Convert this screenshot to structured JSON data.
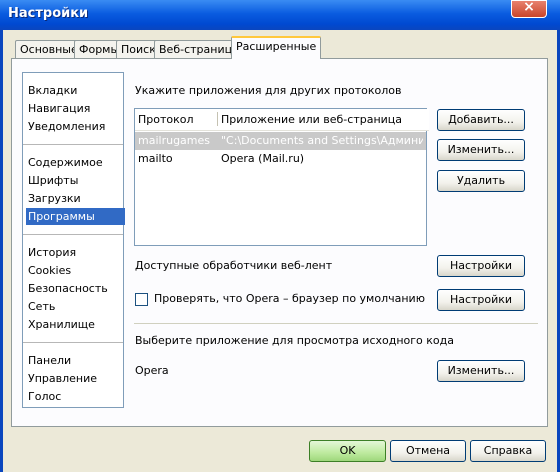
{
  "window": {
    "title": "Настройки"
  },
  "tabs": [
    {
      "label": "Основные",
      "active": false
    },
    {
      "label": "Формы",
      "active": false
    },
    {
      "label": "Поиск",
      "active": false
    },
    {
      "label": "Веб-страницы",
      "active": false
    },
    {
      "label": "Расширенные",
      "active": true
    }
  ],
  "categories": {
    "groups": [
      [
        "Вкладки",
        "Навигация",
        "Уведомления"
      ],
      [
        "Содержимое",
        "Шрифты",
        "Загрузки",
        "Программы"
      ],
      [
        "История",
        "Cookies",
        "Безопасность",
        "Сеть",
        "Хранилище"
      ],
      [
        "Панели",
        "Управление",
        "Голос"
      ]
    ],
    "selected": "Программы"
  },
  "protocols": {
    "heading": "Укажите приложения для других протоколов",
    "columns": [
      "Протокол",
      "Приложение или веб-страница"
    ],
    "rows": [
      {
        "protocol": "mailrugames",
        "app": "\"C:\\Documents and Settings\\Админист...",
        "selected": true
      },
      {
        "protocol": "mailto",
        "app": "Opera (Mail.ru)",
        "selected": false
      }
    ],
    "buttons": {
      "add": "Добавить...",
      "edit": "Изменить...",
      "delete": "Удалить"
    }
  },
  "feeds": {
    "label": "Доступные обработчики веб-лент",
    "button": "Настройки"
  },
  "default_browser": {
    "label": "Проверять, что Opera – браузер по умолчанию",
    "checked": false,
    "button": "Настройки"
  },
  "source_viewer": {
    "heading": "Выберите приложение для просмотра исходного кода",
    "value": "Opera",
    "button": "Изменить..."
  },
  "footer": {
    "ok": "OK",
    "cancel": "Отмена",
    "help": "Справка"
  }
}
